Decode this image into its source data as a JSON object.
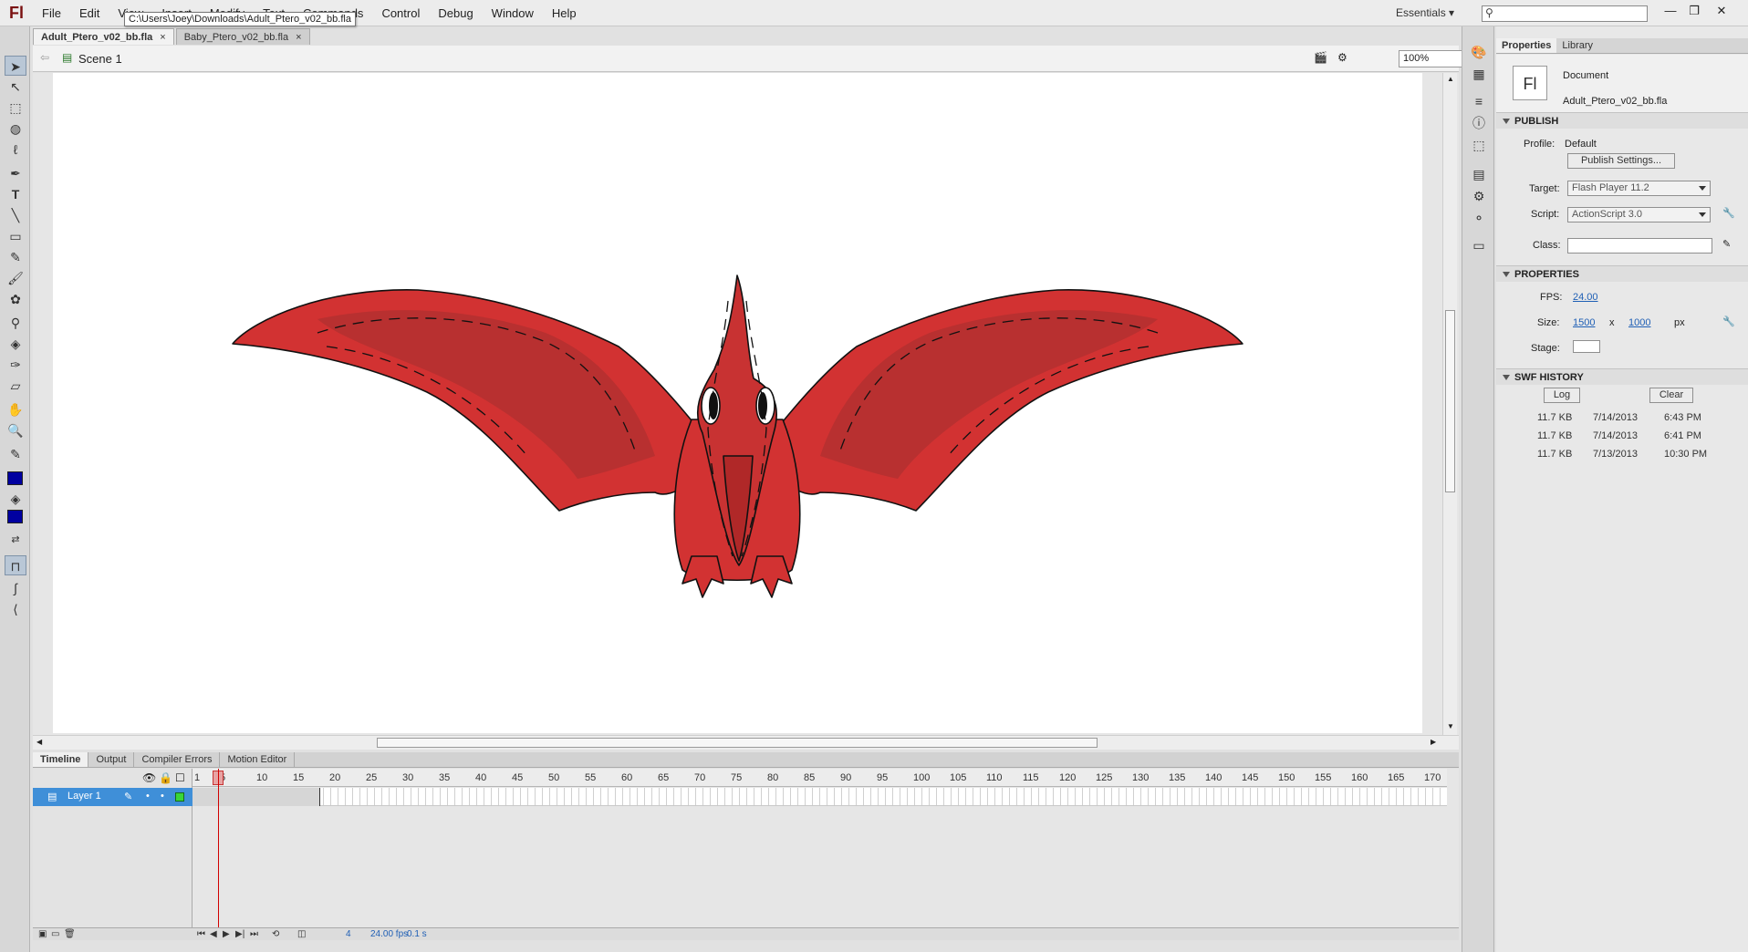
{
  "app": {
    "logo": "Fl",
    "menus": [
      "File",
      "Edit",
      "View",
      "Insert",
      "Modify",
      "Text",
      "Commands",
      "Control",
      "Debug",
      "Window",
      "Help"
    ],
    "workspace": "Essentials",
    "tooltip": "C:\\Users\\Joey\\Downloads\\Adult_Ptero_v02_bb.fla"
  },
  "tabs": [
    {
      "label": "Adult_Ptero_v02_bb.fla",
      "close": "×"
    },
    {
      "label": "Baby_Ptero_v02_bb.fla",
      "close": "×"
    }
  ],
  "editbar": {
    "scene": "Scene 1",
    "zoom": "100%"
  },
  "panel_tabs": [
    "Timeline",
    "Output",
    "Compiler Errors",
    "Motion Editor"
  ],
  "timeline": {
    "layer_name": "Layer 1",
    "ruler": [
      "1",
      "5",
      "10",
      "15",
      "20",
      "25",
      "30",
      "35",
      "40",
      "45",
      "50",
      "55",
      "60",
      "65",
      "70",
      "75",
      "80",
      "85",
      "90",
      "95",
      "100",
      "105",
      "110",
      "115",
      "120",
      "125",
      "130",
      "135",
      "140",
      "145",
      "150",
      "155",
      "160",
      "165",
      "170"
    ],
    "current_frame": "4",
    "fps": "24.00 fps",
    "elapsed": "0.1 s"
  },
  "properties": {
    "tabs": [
      "Properties",
      "Library"
    ],
    "doc_type": "Document",
    "doc_name": "Adult_Ptero_v02_bb.fla",
    "publish": {
      "section": "PUBLISH",
      "profile_label": "Profile:",
      "profile": "Default",
      "settings_button": "Publish Settings...",
      "target_label": "Target:",
      "target": "Flash Player 11.2",
      "script_label": "Script:",
      "script": "ActionScript 3.0",
      "class_label": "Class:"
    },
    "props": {
      "section": "PROPERTIES",
      "fps_label": "FPS:",
      "fps": "24.00",
      "size_label": "Size:",
      "width": "1500",
      "x": "x",
      "height": "1000",
      "unit": "px",
      "stage_label": "Stage:",
      "stage_color": "#ffffff"
    },
    "history": {
      "section": "SWF HISTORY",
      "log_button": "Log",
      "clear_button": "Clear",
      "rows": [
        {
          "size": "11.7 KB",
          "date": "7/14/2013",
          "time": "6:43 PM"
        },
        {
          "size": "11.7 KB",
          "date": "7/14/2013",
          "time": "6:41 PM"
        },
        {
          "size": "11.7 KB",
          "date": "7/13/2013",
          "time": "10:30 PM"
        }
      ]
    }
  },
  "colors": {
    "stroke": "#0000a0",
    "fill": "#0000a0",
    "ptero_red": "#d23232",
    "ptero_dark": "#b83030"
  }
}
